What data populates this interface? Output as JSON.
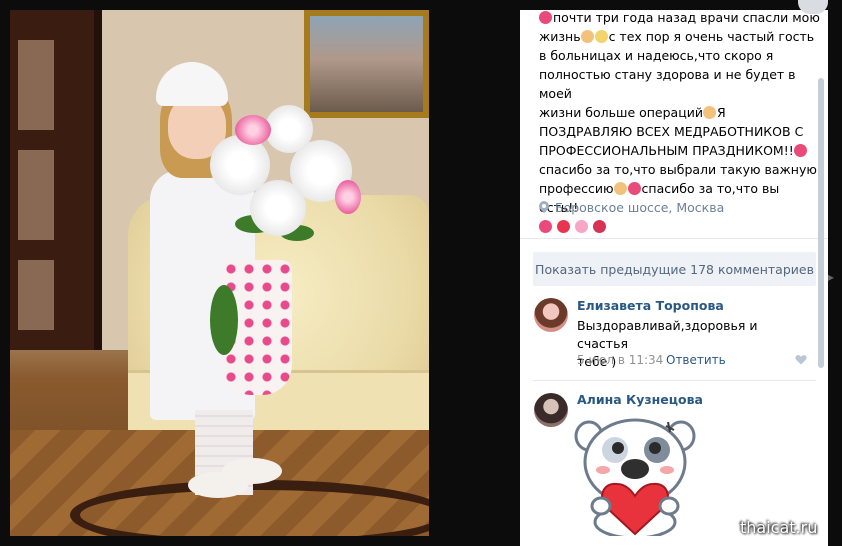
{
  "post": {
    "lines": [
      "почти три года назад врачи спасли мою",
      "жизнь",
      "с тех пор я очень частый гость",
      "в больницах и надеюсь,что скоро я",
      "полностью стану здорова и не будет в моей",
      "жизни больше операций",
      "Я",
      "ПОЗДРАВЛЯЮ ВСЕХ МЕДРАБОТНИКОВ С",
      "ПРОФЕССИОНАЛЬНЫМ ПРАЗДНИКОМ!!",
      "спасибо за то,что выбрали такую важную",
      "профессию",
      "спасибо за то,что вы есть!!"
    ],
    "location": "Боровское шоссе, Москва"
  },
  "comments": {
    "show_previous_label": "Показать предыдущие 178 комментариев",
    "items": [
      {
        "author": "Елизавета Торопова",
        "text_line1": "Выздоравливай,здоровья и счастья",
        "text_line2": "тебе )",
        "date": "5 июл в 11:34",
        "reply_label": "Ответить"
      },
      {
        "author": "Алина Кузнецова"
      }
    ]
  },
  "watermark": "thaicat.ru",
  "colors": {
    "link": "#2a5885",
    "muted": "#939393",
    "button_bg": "#eef1f5",
    "location": "#6d8198"
  },
  "icons": {
    "flower_emoji": "tulip-emoji-icon",
    "praying_hands": "praying-hands-emoji-icon",
    "location": "location-pin-icon",
    "like": "heart-like-icon"
  }
}
